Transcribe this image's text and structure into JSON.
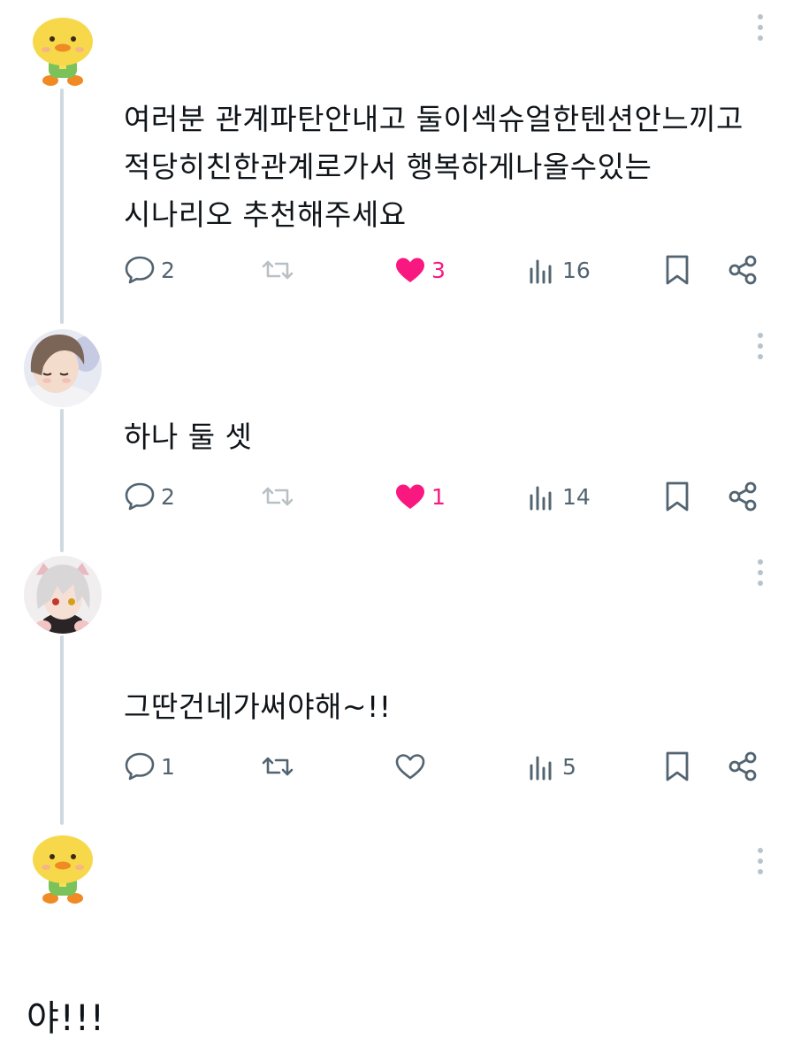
{
  "posts": [
    {
      "avatar": "duck-avatar",
      "text": "여러분 관계파탄안내고 둘이섹슈얼한텐션안느끼고\n적당히친한관계로가서 행복하게나올수있는\n시나리오 추천해주세요",
      "replies": "2",
      "likes": "3",
      "views": "16",
      "liked": true
    },
    {
      "avatar": "brown-hair-avatar",
      "text": "하나 둘 셋",
      "replies": "2",
      "likes": "1",
      "views": "14",
      "liked": true
    },
    {
      "avatar": "white-hair-avatar",
      "text": "그딴건네가써야해~!!",
      "replies": "1",
      "likes": "",
      "views": "5",
      "liked": false
    }
  ],
  "partial_post": {
    "avatar": "duck-avatar",
    "text": "야!!!"
  },
  "colors": {
    "like": "#f91880",
    "icon": "#536471",
    "thread_line": "#cfd9de"
  }
}
